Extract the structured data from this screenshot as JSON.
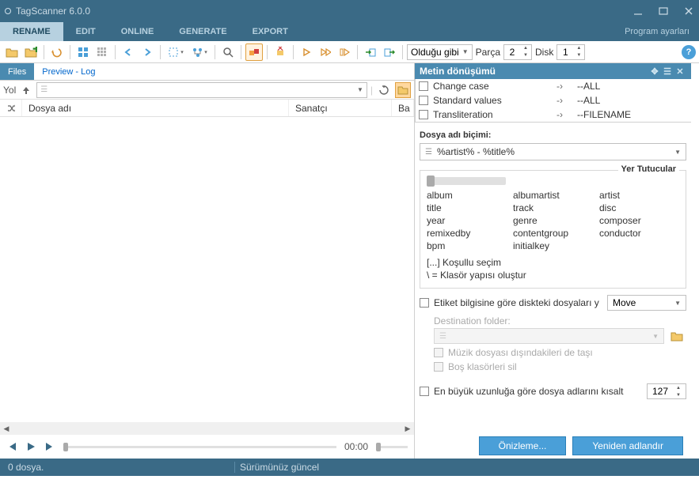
{
  "title": "TagScanner 6.0.0",
  "program_settings": "Program ayarları",
  "menu": [
    "RENAME",
    "EDIT",
    "ONLINE",
    "GENERATE",
    "EXPORT"
  ],
  "toolbar": {
    "sort_label": "Olduğu gibi",
    "parca_label": "Parça",
    "parca_value": "2",
    "disk_label": "Disk",
    "disk_value": "1"
  },
  "left_tabs": {
    "files": "Files",
    "preview": "Preview - Log"
  },
  "path_label": "Yol",
  "path_placeholder": "",
  "columns": {
    "name": "Dosya adı",
    "artist": "Sanatçı",
    "ba": "Ba"
  },
  "player_time": "00:00",
  "panel_title": "Metin dönüşümü",
  "transforms": [
    {
      "name": "Change case",
      "target": "--ALL"
    },
    {
      "name": "Standard values",
      "target": "--ALL"
    },
    {
      "name": "Transliteration",
      "target": "--FILENAME"
    }
  ],
  "format_label": "Dosya adı biçimi:",
  "format_value": "%artist% - %title%",
  "placeholders_title": "Yer Tutucular",
  "placeholders": [
    "album",
    "albumartist",
    "artist",
    "title",
    "track",
    "disc",
    "year",
    "genre",
    "composer",
    "remixedby",
    "contentgroup",
    "conductor",
    "bpm",
    "initialkey",
    ""
  ],
  "placeholder_notes": [
    "[...] Koşullu seçim",
    "\\ = Klasör yapısı oluştur"
  ],
  "opt_reorganize": "Etiket bilgisine göre diskteki dosyaları y",
  "opt_reorganize_mode": "Move",
  "dest_label": "Destination folder:",
  "opt_move_nonmusic": "Müzik dosyası dışındakileri de taşı",
  "opt_delete_empty": "Boş klasörleri sil",
  "opt_truncate": "En büyük uzunluğa göre dosya adlarını kısalt",
  "truncate_value": "127",
  "btn_preview": "Önizleme...",
  "btn_rename": "Yeniden adlandır",
  "status_files": "0 dosya.",
  "status_version": "Sürümünüz güncel"
}
